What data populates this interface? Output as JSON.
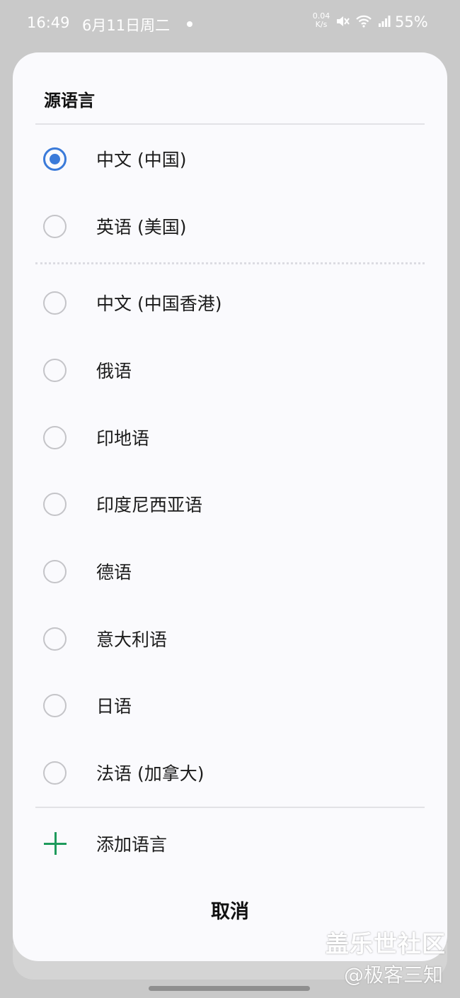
{
  "status_bar": {
    "time": "16:49",
    "date": "6月11日周二",
    "speed_value": "0.04",
    "speed_unit": "K/s",
    "battery": "55%"
  },
  "dialog": {
    "title": "源语言",
    "pinned_options": [
      {
        "label": "中文 (中国)",
        "selected": true
      },
      {
        "label": "英语 (美国)",
        "selected": false
      }
    ],
    "options": [
      {
        "label": "中文 (中国香港)",
        "selected": false
      },
      {
        "label": "俄语",
        "selected": false
      },
      {
        "label": "印地语",
        "selected": false
      },
      {
        "label": "印度尼西亚语",
        "selected": false
      },
      {
        "label": "德语",
        "selected": false
      },
      {
        "label": "意大利语",
        "selected": false
      },
      {
        "label": "日语",
        "selected": false
      },
      {
        "label": "法语 (加拿大)",
        "selected": false
      }
    ],
    "add_language_label": "添加语言",
    "cancel_label": "取消"
  },
  "watermark": {
    "line1": "盖乐世社区",
    "line2": "@极客三知"
  },
  "colors": {
    "accent": "#3a7ad9",
    "add_icon": "#1e9a5c"
  }
}
